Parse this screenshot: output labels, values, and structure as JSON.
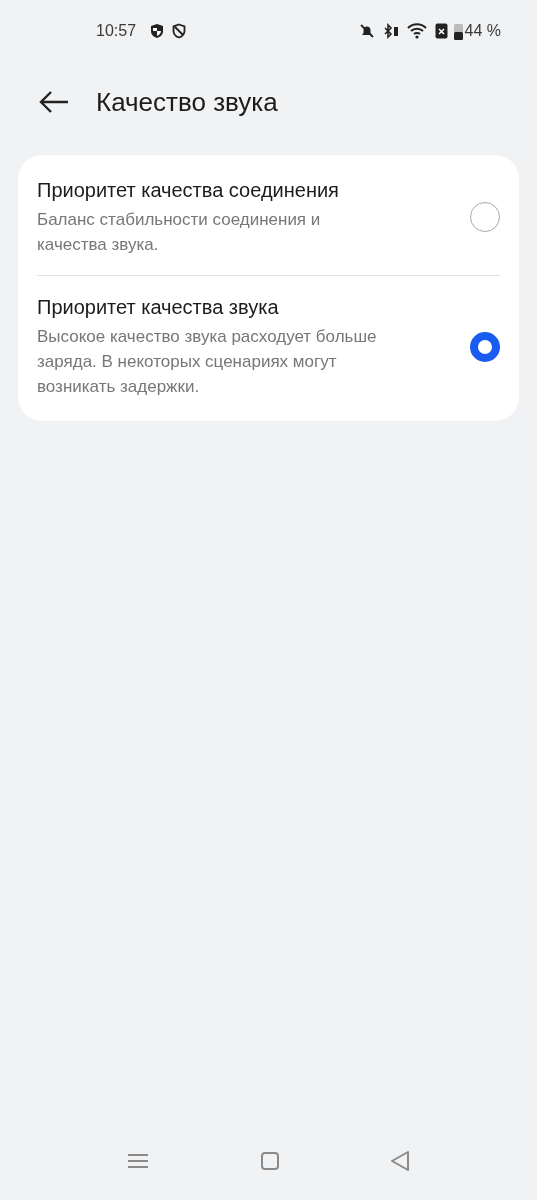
{
  "status_bar": {
    "time": "10:57",
    "battery_percent": "44 %"
  },
  "header": {
    "title": "Качество звука"
  },
  "options": [
    {
      "title": "Приоритет качества соединения",
      "description": "Баланс стабильности соединения и качества звука.",
      "selected": false
    },
    {
      "title": "Приоритет качества звука",
      "description": "Высокое качество звука расходует больше заряда. В некоторых сценариях могут возникать задержки.",
      "selected": true
    }
  ]
}
